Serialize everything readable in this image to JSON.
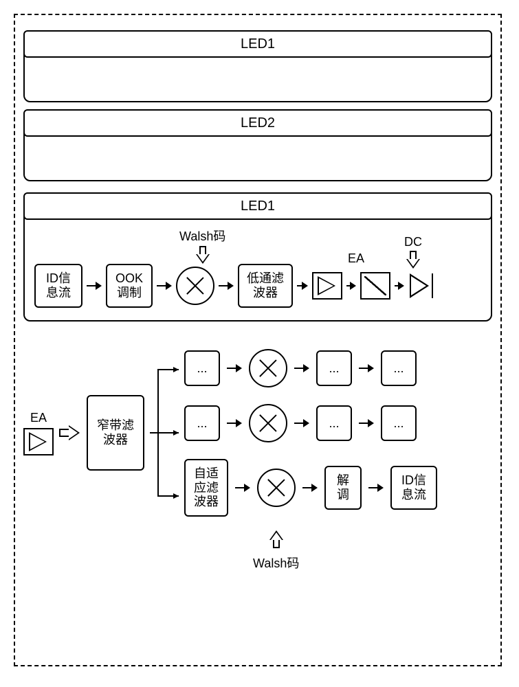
{
  "leds": {
    "led1": "LED1",
    "led2": "LED2",
    "led1_detail": "LED1"
  },
  "tx": {
    "id_stream": "ID信\n息流",
    "ook": "OOK\n调制",
    "walsh": "Walsh码",
    "lpf": "低通滤\n波器",
    "ea": "EA",
    "dc": "DC"
  },
  "rx": {
    "ea": "EA",
    "nbf": "窄带滤\n波器",
    "dots": "...",
    "adaptive": "自适\n应滤\n波器",
    "demod": "解\n调",
    "id_stream": "ID信\n息流",
    "walsh": "Walsh码"
  }
}
